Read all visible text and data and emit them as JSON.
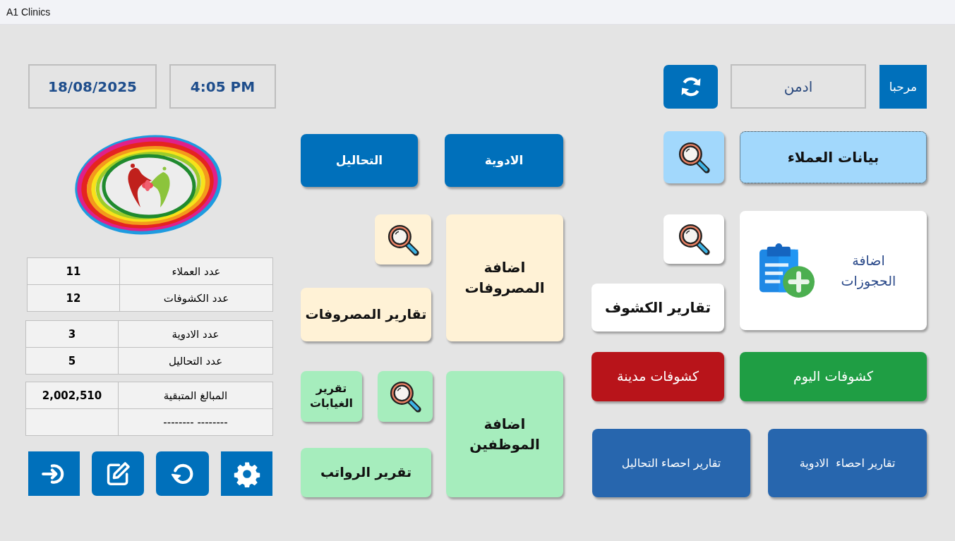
{
  "window": {
    "title": "A1 Clinics"
  },
  "date": "18/08/2025",
  "time": "4:05 PM",
  "welcome_label": "مرحبا",
  "user_field": {
    "value": "ادمن"
  },
  "stats_tables": [
    {
      "rows": [
        {
          "label": "عدد العملاء",
          "value": "11"
        },
        {
          "label": "عدد الكشوفات",
          "value": "12"
        }
      ]
    },
    {
      "rows": [
        {
          "label": "عدد الادوية",
          "value": "3"
        },
        {
          "label": "عدد التحاليل",
          "value": "5"
        }
      ]
    },
    {
      "rows": [
        {
          "label": "المبالغ المتبقية",
          "value": "2,002,510"
        },
        {
          "label": "-------- --------"
        }
      ]
    }
  ],
  "catalog_buttons": [
    {
      "label": "الادوية"
    },
    {
      "label": "التحاليل"
    }
  ],
  "expenses": {
    "add_button": "اضافة المصروفات",
    "report_button": "تقارير المصروفات"
  },
  "employees": {
    "absence_report_button": "تقرير الغيابات",
    "salary_report_button": "تقرير الرواتب",
    "add_button": "اضافة الموظفين"
  },
  "clients_button": {
    "label": "بيانات العملاء",
    "focused": true
  },
  "bookings": {
    "add_button": "اضافة الحجوزات",
    "report_button": "تقارير الكشوف"
  },
  "visit_buttons": [
    {
      "label": "كشوفات اليوم",
      "color": "#1f9e44"
    },
    {
      "label": "كشوفات مدينة",
      "color": "#b8141a"
    }
  ],
  "stats_report_buttons": [
    {
      "label": "تقارير احصاء  الادوية"
    },
    {
      "label": "تقارير احصاء التحاليل"
    }
  ]
}
